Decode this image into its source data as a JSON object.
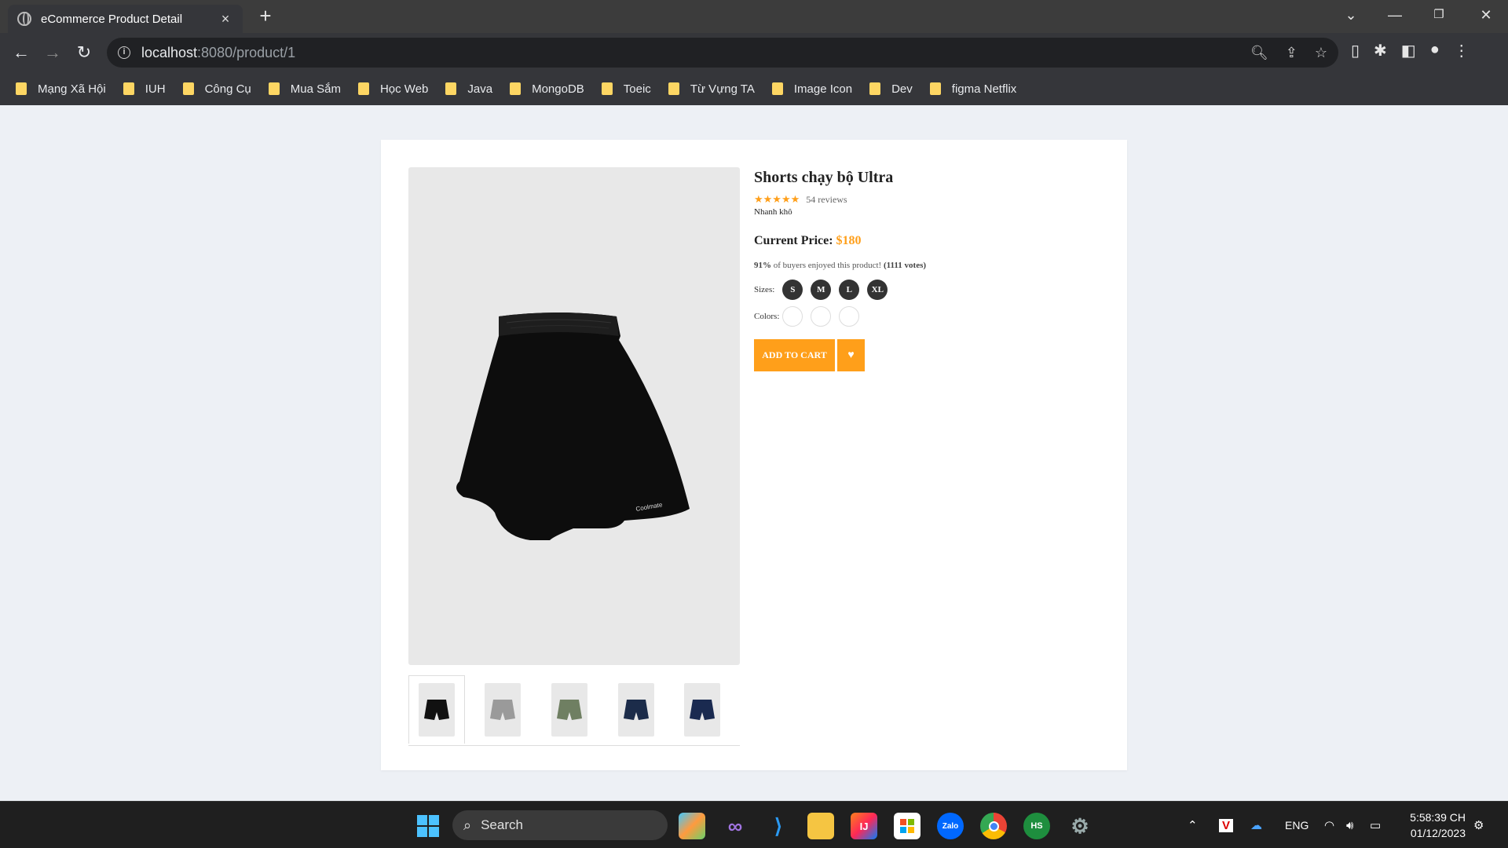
{
  "browser": {
    "tab_title": "eCommerce Product Detail",
    "tab_close": "×",
    "new_tab": "+",
    "url_host": "localhost",
    "url_path": ":8080/product/1",
    "window_controls": [
      "chevron-down",
      "minimize",
      "restore",
      "close"
    ]
  },
  "bookmarks": [
    "Mạng Xã Hội",
    "IUH",
    "Công Cụ",
    "Mua Sắm",
    "Học Web",
    "Java",
    "MongoDB",
    "Toeic",
    "Từ Vựng TA",
    "Image Icon",
    "Dev",
    "figma Netflix"
  ],
  "product": {
    "title": "Shorts chạy bộ Ultra",
    "stars": "★★★★★",
    "reviews": "54 reviews",
    "feature": "Nhanh khô",
    "price_label": "Current Price:",
    "price": "$180",
    "vote_percent": "91%",
    "vote_text": " of buyers enjoyed this product! ",
    "vote_count": "(1111 votes)",
    "sizes_label": "Sizes:",
    "sizes": [
      "S",
      "M",
      "L",
      "XL"
    ],
    "colors_label": "Colors:",
    "colors": [
      "#ffffff",
      "#ffffff",
      "#ffffff"
    ],
    "add_to_cart": "ADD TO CART",
    "like_icon": "♥",
    "brand_print": "Coolmate",
    "thumbnails": [
      "#111111",
      "#9a9a9a",
      "#6f7f62",
      "#1c2c4a",
      "#1a2a50"
    ]
  },
  "taskbar": {
    "search": "Search",
    "lang": "ENG",
    "time": "5:58:39 CH",
    "date": "01/12/2023"
  }
}
